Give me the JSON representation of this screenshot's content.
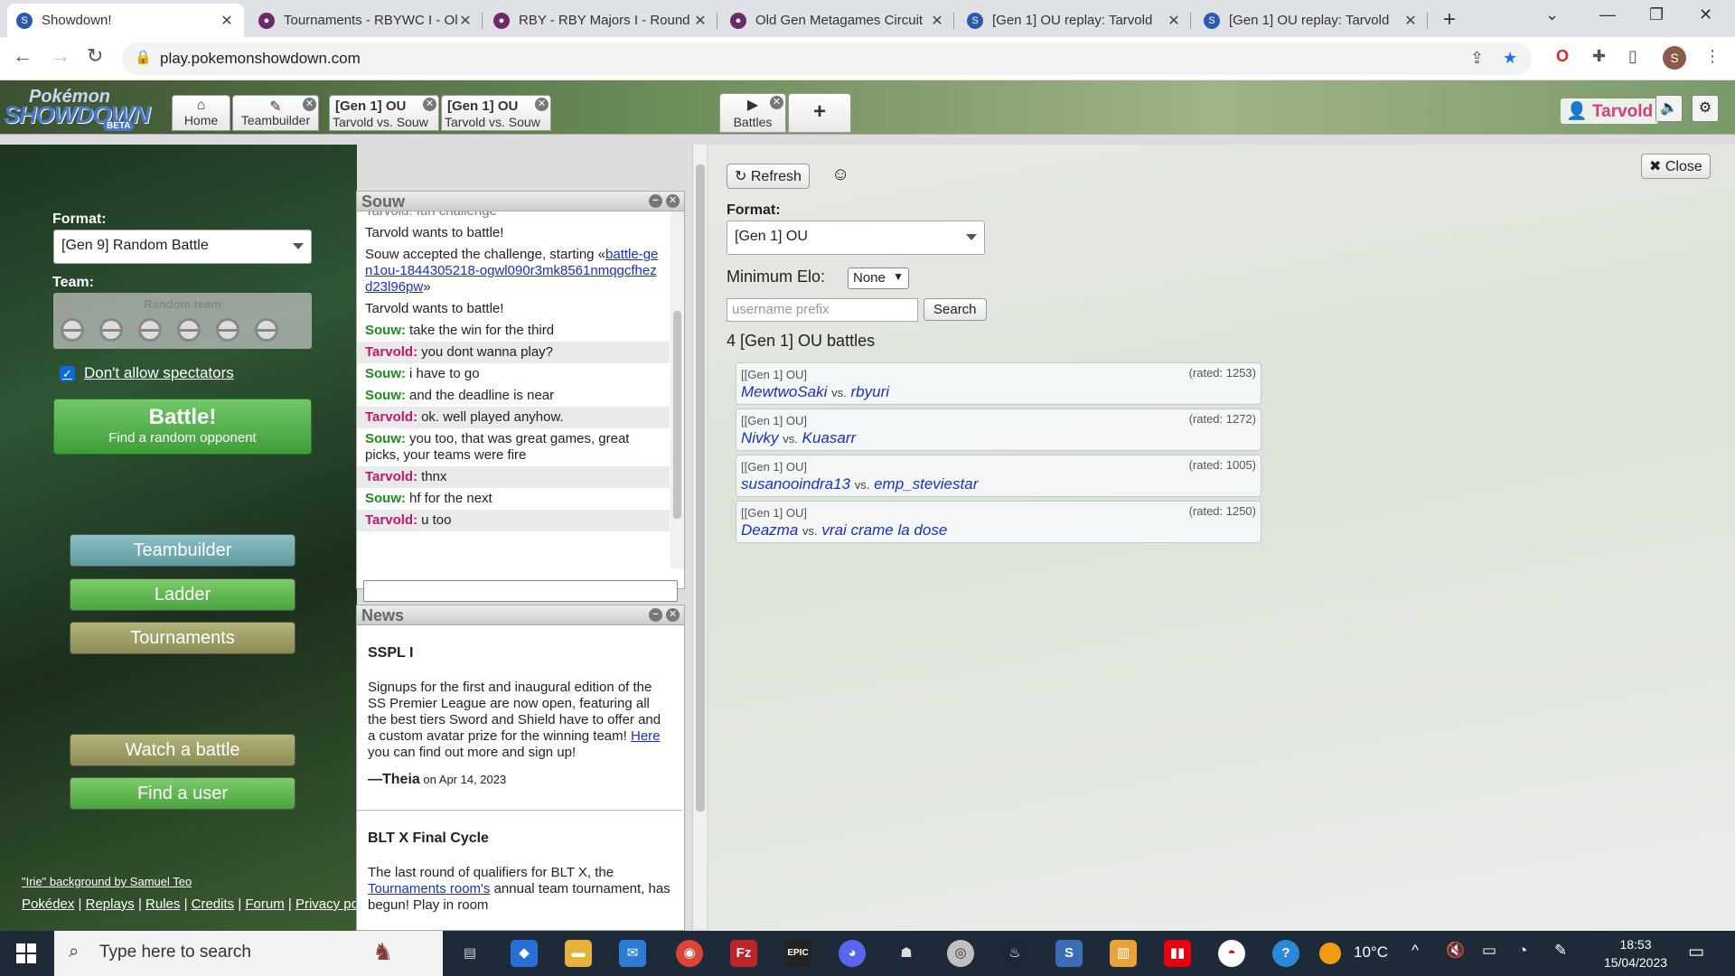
{
  "browser": {
    "tabs": [
      {
        "title": "Showdown!",
        "active": true,
        "icon": "showdown-icon"
      },
      {
        "title": "Tournaments - RBYWC I - Ol",
        "active": false,
        "icon": "pokeball-icon"
      },
      {
        "title": "RBY - RBY Majors I - Round",
        "active": false,
        "icon": "pokeball-icon"
      },
      {
        "title": "Old Gen Metagames Circuit",
        "active": false,
        "icon": "pokeball-icon"
      },
      {
        "title": "[Gen 1] OU replay: Tarvold",
        "active": false,
        "icon": "showdown-icon"
      },
      {
        "title": "[Gen 1] OU replay: Tarvold",
        "active": false,
        "icon": "showdown-icon"
      }
    ],
    "url": "play.pokemonshowdown.com",
    "profile_initial": "S"
  },
  "header": {
    "logo_text_1": "Pokémon",
    "logo_text_2": "SHOWDOWN",
    "logo_badge": "BETA",
    "tabs": {
      "home": "Home",
      "teambuilder": "Teambuilder",
      "battle1_format": "[Gen 1] OU",
      "battle1_players": "Tarvold vs. Souw",
      "battle2_format": "[Gen 1] OU",
      "battle2_players": "Tarvold vs. Souw",
      "battles": "Battles",
      "add": "+"
    },
    "username": "Tarvold"
  },
  "left": {
    "format_label": "Format:",
    "format_value": "[Gen 9] Random Battle",
    "team_label": "Team:",
    "team_value": "Random team",
    "spectators_label": "Don't allow spectators",
    "battle_button": "Battle!",
    "battle_sub": "Find a random opponent",
    "menu": {
      "teambuilder": "Teambuilder",
      "ladder": "Ladder",
      "tournaments": "Tournaments",
      "watch": "Watch a battle",
      "find_user": "Find a user"
    },
    "credit": "\"Irie\" background by Samuel Teo",
    "footer": [
      "Pokédex",
      "Replays",
      "Rules",
      "Credits",
      "Forum",
      "Privacy policy"
    ]
  },
  "chat": {
    "title": "Souw",
    "clipped_line": "Tarvold: fun challenge",
    "lines": [
      {
        "text": "Tarvold wants to battle!"
      },
      {
        "text": "Souw accepted the challenge, starting «",
        "link": "battle-gen1ou-1844305218-ogwl090r3mk8561nmqgcfhezd23l96pw",
        "after": "»"
      },
      {
        "text": "Tarvold wants to battle!"
      }
    ],
    "messages": [
      {
        "user": "Souw:",
        "text": "take the win for the third"
      },
      {
        "user": "Tarvold:",
        "text": "you dont wanna play?"
      },
      {
        "user": "Souw:",
        "text": "i have to go"
      },
      {
        "user": "Souw:",
        "text": "and the deadline is near"
      },
      {
        "user": "Tarvold:",
        "text": "ok. well played anyhow."
      },
      {
        "user": "Souw:",
        "text": "you too, that was great games, great picks, your teams were fire"
      },
      {
        "user": "Tarvold:",
        "text": "thnx"
      },
      {
        "user": "Souw:",
        "text": "hf for the next"
      },
      {
        "user": "Tarvold:",
        "text": "u too"
      }
    ]
  },
  "news": {
    "title": "News",
    "items": [
      {
        "heading": "SSPL I",
        "body_before": "Signups for the first and inaugural edition of the SS Premier League are now open, featuring all the best tiers Sword and Shield have to offer and a custom avatar prize for the winning team! ",
        "link": "Here",
        "body_after": " you can find out more and sign up!",
        "author": "—Theia",
        "date": "on Apr 14, 2023"
      },
      {
        "heading": "BLT X Final Cycle",
        "body_before": "The last round of qualifiers for BLT X, the ",
        "link": "Tournaments room's",
        "body_after": " annual team tournament, has begun! Play in room"
      }
    ]
  },
  "battles": {
    "refresh": "Refresh",
    "close": "Close",
    "format_label": "Format:",
    "format_value": "[Gen 1] OU",
    "min_elo_label": "Minimum Elo:",
    "min_elo_value": "None",
    "username_placeholder": "username prefix",
    "search": "Search",
    "count_text": "4 [Gen 1] OU battles",
    "vs": "vs.",
    "list": [
      {
        "format": "[[Gen 1] OU]",
        "rated": "(rated: 1253)",
        "p1": "MewtwoSaki",
        "p2": "rbyuri"
      },
      {
        "format": "[[Gen 1] OU]",
        "rated": "(rated: 1272)",
        "p1": "Nivky",
        "p2": "Kuasarr"
      },
      {
        "format": "[[Gen 1] OU]",
        "rated": "(rated: 1005)",
        "p1": "susanooindra13",
        "p2": "emp_steviestar"
      },
      {
        "format": "[[Gen 1] OU]",
        "rated": "(rated: 1250)",
        "p1": "Deazma",
        "p2": "vrai crame la dose"
      }
    ]
  },
  "taskbar": {
    "search_placeholder": "Type here to search",
    "temperature": "10°C",
    "time": "18:53",
    "date": "15/04/2023"
  }
}
